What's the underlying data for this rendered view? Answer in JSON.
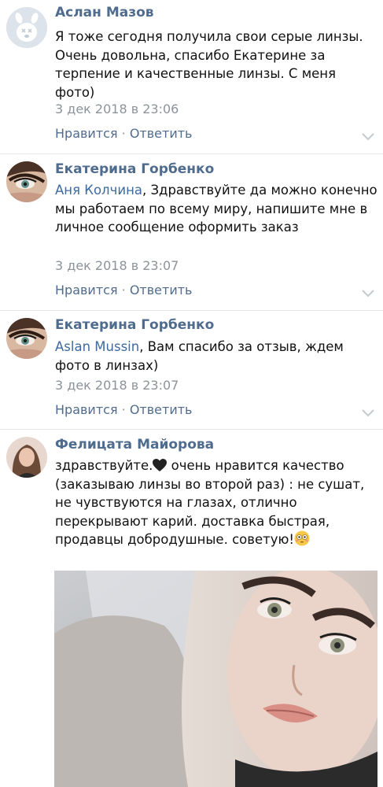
{
  "comments": [
    {
      "author": "Аслан Мазов",
      "text": "Я тоже сегодня получила свои серые линзы. Очень довольна, спасибо Екатерине за терпение и качественные линзы. С меня фото)",
      "date": "3 дек 2018 в 23:06",
      "like_label": "Нравится",
      "separator": " · ",
      "reply_label": "Ответить"
    },
    {
      "author": "Екатерина Горбенко",
      "mention": "Аня Колчина",
      "text": ", Здравствуйте да можно конечно мы работаем по всему миру, напишите мне в личное сообщение оформить заказ",
      "date": "3 дек 2018 в 23:07",
      "like_label": "Нравится",
      "separator": " · ",
      "reply_label": "Ответить"
    },
    {
      "author": "Екатерина Горбенко",
      "mention": "Aslan Mussin",
      "text": ", Вам спасибо за отзыв, ждем фото в линзах)",
      "date": "3 дек 2018 в 23:07",
      "like_label": "Нравится",
      "separator": " · ",
      "reply_label": "Ответить"
    },
    {
      "author": "Фелицата Майорова",
      "text_before_emoji": "здравствуйте.",
      "text_after_heart": " очень нравится качество (заказываю линзы во второй раз) : не сушат, не чувствуются на глазах, отлично перекрывают карий. доставка быстрая, продавцы добродушные. советую!",
      "icons": [
        "black-heart-icon",
        "flushed-face-emoji-icon"
      ]
    }
  ],
  "colors": {
    "author": "#4f6c8e",
    "link": "#4f6c8e",
    "date": "#8d939a",
    "divider": "#e4e6e9"
  }
}
